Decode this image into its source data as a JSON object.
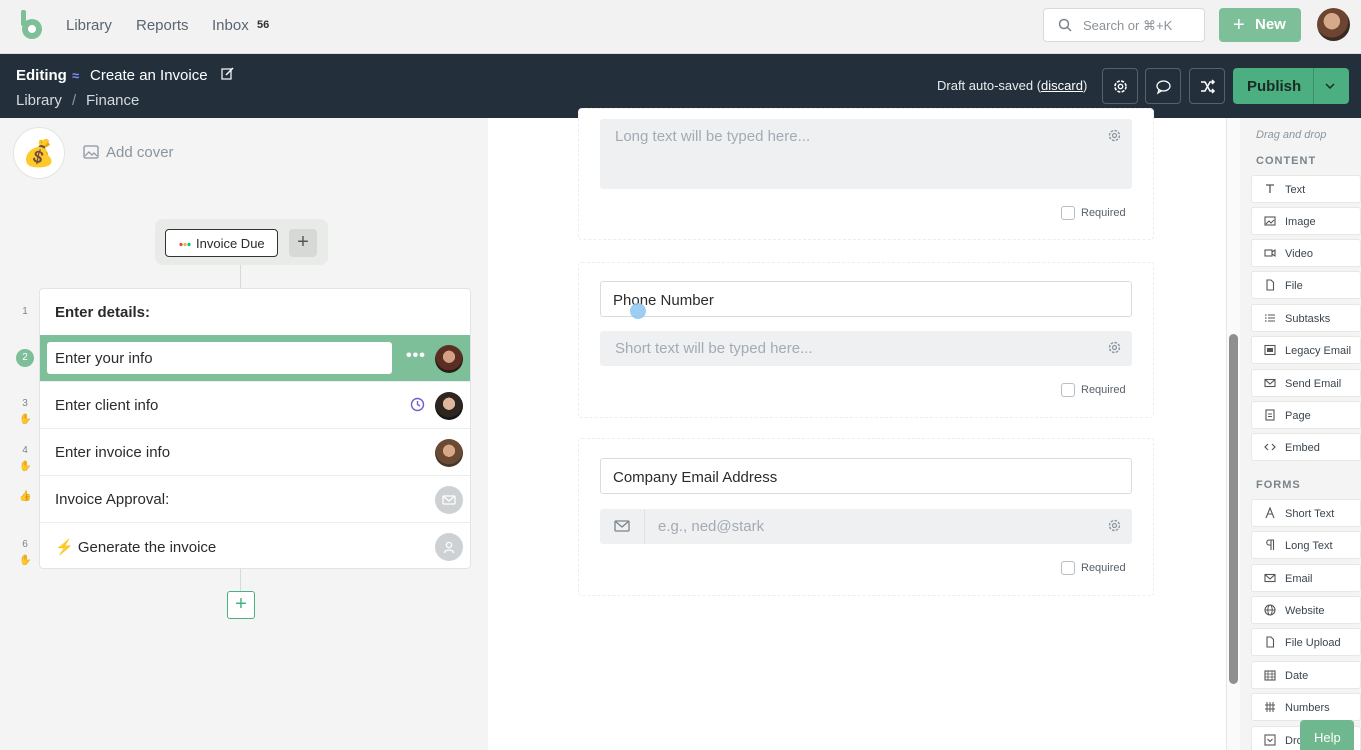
{
  "nav": {
    "links": [
      "Library",
      "Reports",
      "Inbox"
    ],
    "inbox_count": "56",
    "search_placeholder": "Search or ⌘+K",
    "new_label": "New"
  },
  "editbar": {
    "mode": "Editing",
    "title": "Create an Invoice",
    "breadcrumb": [
      "Library",
      "/",
      "Finance"
    ],
    "autosave_prefix": "Draft auto-saved (",
    "discard": "discard",
    "autosave_suffix": ")",
    "publish_label": "Publish"
  },
  "left": {
    "emoji": "💰",
    "add_cover": "Add cover",
    "trigger_label": "Invoice Due",
    "tasks": [
      {
        "num": "1",
        "label": "Enter details:"
      },
      {
        "num": "2",
        "label": "Enter your info"
      },
      {
        "num": "3",
        "label": "Enter client info"
      },
      {
        "num": "4",
        "label": "Enter invoice info"
      },
      {
        "num": "",
        "label": "Invoice Approval:"
      },
      {
        "num": "6",
        "label": "⚡ Generate the invoice"
      }
    ]
  },
  "form": {
    "long_text_placeholder": "Long text will be typed here...",
    "phone_label": "Phone Number",
    "short_text_placeholder": "Short text will be typed here...",
    "email_label": "Company Email Address",
    "email_placeholder": "e.g., ned@stark",
    "required_label": "Required"
  },
  "sidebar": {
    "hint": "Drag and drop",
    "content_title": "CONTENT",
    "content_items": [
      "Text",
      "Image",
      "Video",
      "File",
      "Subtasks",
      "Legacy Email",
      "Send Email",
      "Page",
      "Embed"
    ],
    "forms_title": "FORMS",
    "form_items": [
      "Short Text",
      "Long Text",
      "Email",
      "Website",
      "File Upload",
      "Date",
      "Numbers",
      "Dro"
    ]
  },
  "help_label": "Help",
  "colors": {
    "accent": "#4caf82",
    "active_row": "#7dbf98",
    "header_bg": "#23303c"
  }
}
